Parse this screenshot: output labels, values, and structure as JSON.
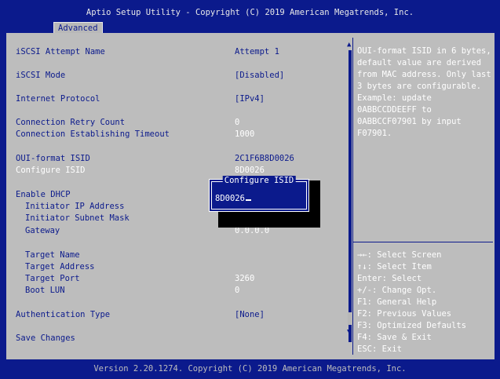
{
  "header": {
    "title": "Aptio Setup Utility - Copyright (C) 2019 American Megatrends, Inc.",
    "active_tab": "Advanced"
  },
  "settings": [
    {
      "label": "iSCSI Attempt Name",
      "value": "Attempt 1"
    },
    {
      "label": "iSCSI Mode",
      "value": "[Disabled]"
    },
    {
      "label": "Internet Protocol",
      "value": "[IPv4]"
    },
    {
      "label": "Connection Retry Count",
      "value": "0"
    },
    {
      "label": "Connection Establishing Timeout",
      "value": "1000"
    },
    {
      "label": "OUI-format ISID",
      "value": "2C1F6B8D0026"
    },
    {
      "label": "Configure ISID",
      "value": "8D0026"
    },
    {
      "label": "Enable DHCP",
      "value": ""
    },
    {
      "label": "Initiator IP Address",
      "value": ""
    },
    {
      "label": "Initiator Subnet Mask",
      "value": ""
    },
    {
      "label": "Gateway",
      "value": "0.0.0.0"
    },
    {
      "label": "Target Name",
      "value": ""
    },
    {
      "label": "Target Address",
      "value": ""
    },
    {
      "label": "Target Port",
      "value": "3260"
    },
    {
      "label": "Boot LUN",
      "value": "0"
    },
    {
      "label": "Authentication Type",
      "value": "[None]"
    },
    {
      "label": "Save Changes",
      "value": ""
    }
  ],
  "help_text": "OUI-format ISID in 6 bytes,\ndefault value are derived\nfrom MAC address. Only last\n3 bytes are configurable.\nExample: update\n0ABBCCDDEEFF to\n0ABBCCF07901 by input\nF07901.",
  "key_help": [
    "→←: Select Screen",
    "↑↓: Select Item",
    "Enter: Select",
    "+/-: Change Opt.",
    "F1: General Help",
    "F2: Previous Values",
    "F3: Optimized Defaults",
    "F4: Save & Exit",
    "ESC: Exit"
  ],
  "dialog": {
    "title": "Configure ISID",
    "value": "8D0026"
  },
  "footer": "Version 2.20.1274. Copyright (C) 2019 American Megatrends, Inc.",
  "colors": {
    "background": "#0b1a8c",
    "panel": "#bdbdbd",
    "highlight": "#ffffff"
  }
}
